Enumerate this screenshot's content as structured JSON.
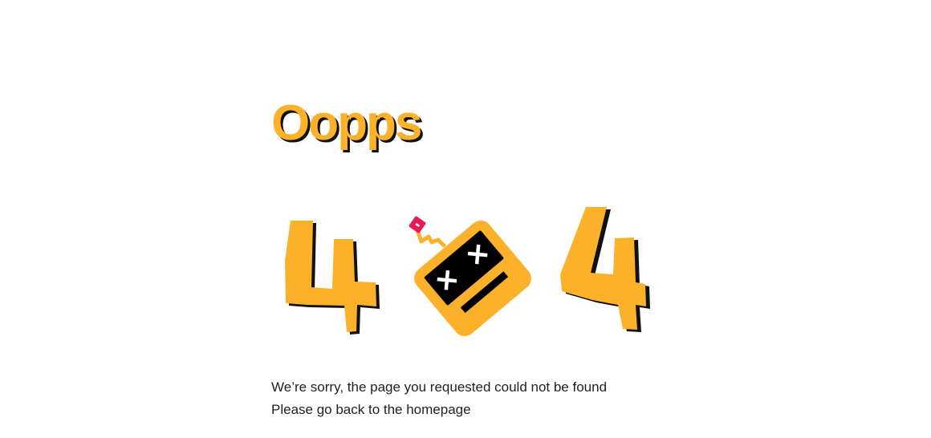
{
  "heading": "Oopps",
  "illustration": {
    "digit_left": "4",
    "digit_right": "4",
    "middle_icon": "dead-robot-battery-icon"
  },
  "message": {
    "line1": "We’re sorry, the page you requested could not be found",
    "line2": "Please go back to the homepage"
  },
  "colors": {
    "accent": "#FBB12A",
    "shadow": "#111111",
    "screen": "#000000",
    "antenna_tip": "#E8185B",
    "text": "#1f1f1f"
  }
}
